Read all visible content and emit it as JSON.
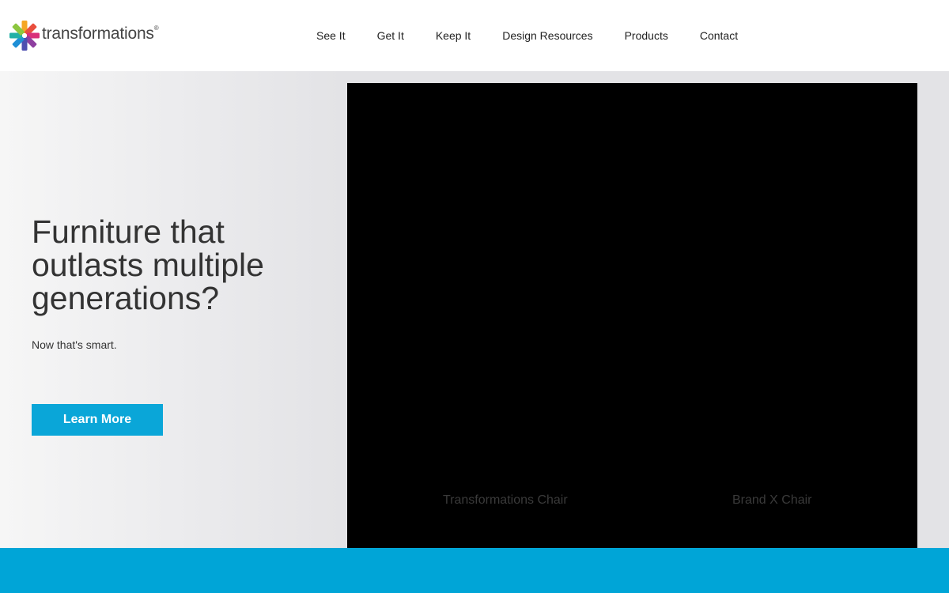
{
  "header": {
    "logo_text": "transformations",
    "logo_mark": "®",
    "logo_icon": "colorful-pinwheel-icon"
  },
  "nav": {
    "items": [
      {
        "label": "See It"
      },
      {
        "label": "Get It"
      },
      {
        "label": "Keep It"
      },
      {
        "label": "Design Resources"
      },
      {
        "label": "Products"
      },
      {
        "label": "Contact"
      }
    ]
  },
  "hero": {
    "title": "Furniture that outlasts multiple generations?",
    "subtitle": "Now that's smart.",
    "cta_label": "Learn More"
  },
  "video": {
    "caption_left": "Transformations Chair",
    "caption_right": "Brand X Chair"
  },
  "colors": {
    "accent": "#0aa6d8",
    "footer_band": "#00a5d7"
  }
}
